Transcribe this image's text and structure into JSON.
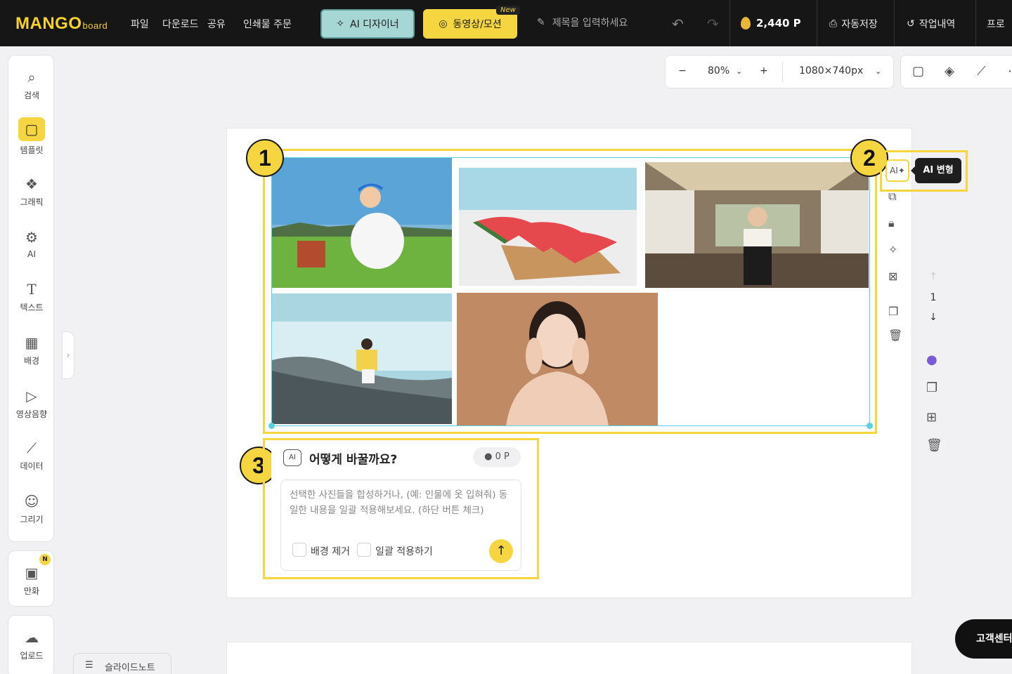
{
  "topbar": {
    "logo_main": "MANGO",
    "logo_sub": "board",
    "menu": [
      "파일",
      "다운로드",
      "공유",
      "인쇄물 주문"
    ],
    "ai_designer": "AI 디자이너",
    "video_motion": "동영상/모션",
    "new_badge": "New",
    "title_placeholder": "제목을 입력하세요",
    "points": "2,440 P",
    "autosave": "자동저장",
    "history": "작업내역",
    "profile": "프로"
  },
  "sidebar": {
    "items": [
      "검색",
      "템플릿",
      "그래픽",
      "AI",
      "텍스트",
      "배경",
      "영상음향",
      "데이터",
      "그리기"
    ],
    "comic": "만화",
    "comic_badge": "N",
    "upload": "업로드"
  },
  "zoom": {
    "value": "80%",
    "size": "1080×740px"
  },
  "canvas": {
    "badges": [
      "1",
      "2",
      "3"
    ],
    "ai_transform_tooltip": "AI 변형",
    "page_number": "1"
  },
  "ai_panel": {
    "title": "어떻게 바꿀까요?",
    "cost": "0 P",
    "placeholder": "선택한 사진들을 합성하거나, (예: 인물에 옷 입혀줘) 동일한 내용을 일괄 적용해보세요. (하단 버튼 체크)",
    "option_remove_bg": "배경 제거",
    "option_batch": "일괄 적용하기"
  },
  "footer": {
    "customer_center": "고객센터",
    "slide_note": "슬라이드노트"
  },
  "colors": {
    "accent": "#f5d640",
    "selection": "#5ad0e0",
    "topbar": "#161616"
  }
}
